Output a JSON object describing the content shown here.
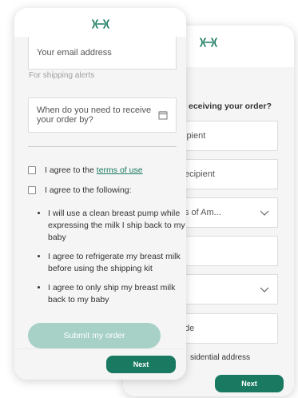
{
  "back_screen": {
    "heading": "eceiving your order?",
    "fields": [
      {
        "text": "ipient"
      },
      {
        "text": "ecipient"
      },
      {
        "text": "s of Am..."
      },
      {
        "text": ""
      },
      {
        "text": ""
      },
      {
        "text": "de"
      }
    ],
    "residential_label": "sidential address",
    "next_label": "Next"
  },
  "front_screen": {
    "email_placeholder": "Your email address",
    "email_hint": "For shipping alerts",
    "date_placeholder": "When do you need to receive your order by?",
    "agree_terms_prefix": "I agree to the ",
    "agree_terms_link": "terms of use",
    "agree_following": "I agree to the following:",
    "bullets": [
      "I will use a clean breast pump while expressing the milk I ship back to my baby",
      "I agree to refrigerate my breast milk before using the shipping kit",
      "I agree to only ship my breast milk back to my baby"
    ],
    "submit_label": "Submit my order",
    "next_label": "Next"
  },
  "colors": {
    "brand_green": "#1a7a61",
    "submit_disabled": "#a7d1c7"
  },
  "icons": {
    "logo": "logo-icon",
    "calendar": "calendar-icon",
    "chevron": "chevron-down-icon"
  }
}
